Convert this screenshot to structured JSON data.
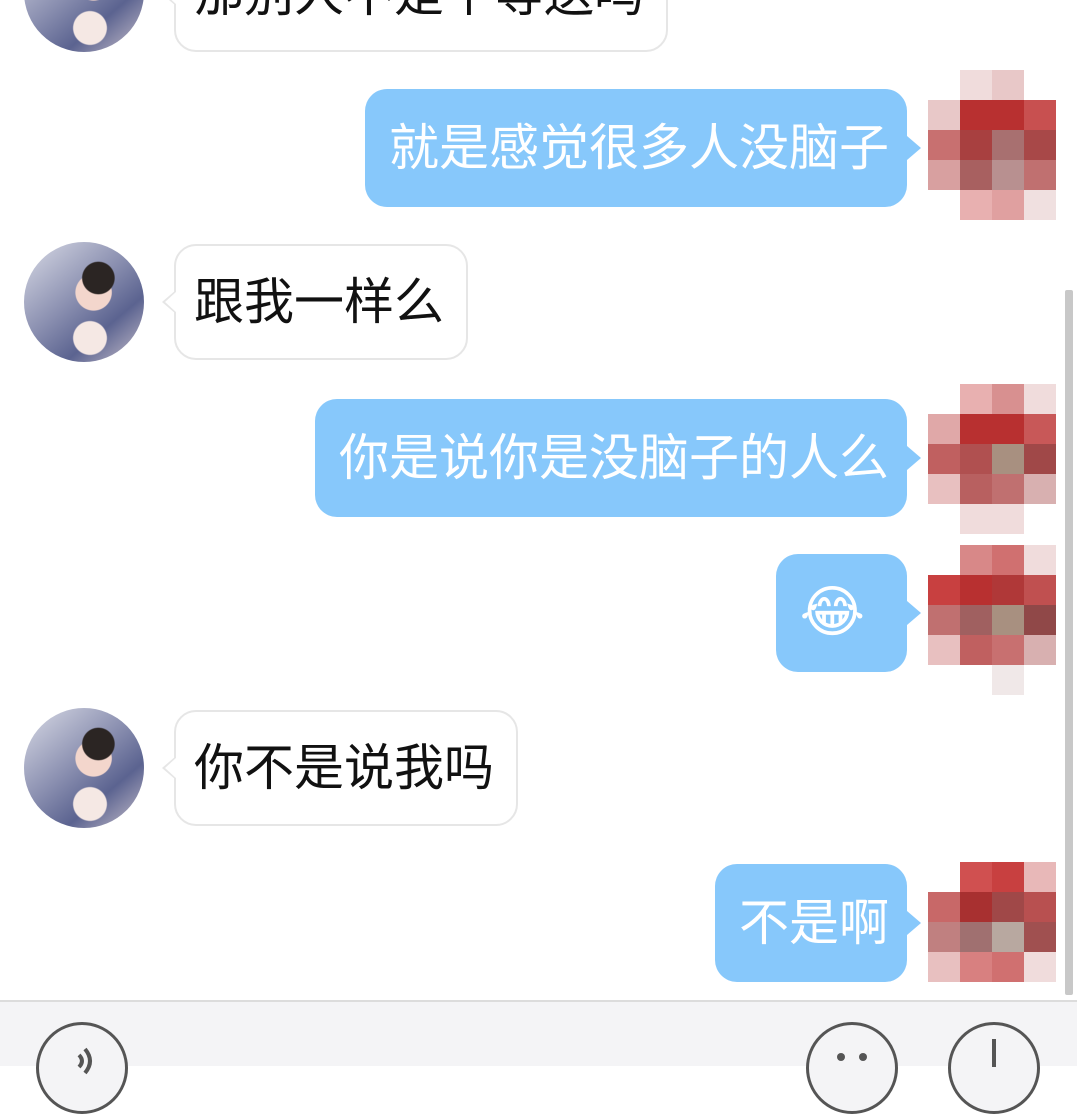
{
  "messages": [
    {
      "side": "in",
      "text": "那别人不是个等送吗"
    },
    {
      "side": "out",
      "text": "就是感觉很多人没脑子"
    },
    {
      "side": "in",
      "text": "跟我一样么"
    },
    {
      "side": "out",
      "text": "你是说你是没脑子的人么"
    },
    {
      "side": "out",
      "text": "😂"
    },
    {
      "side": "in",
      "text": "你不是说我吗"
    },
    {
      "side": "out",
      "text": "不是啊"
    }
  ],
  "input_bar": {
    "voice_icon": "voice-icon",
    "emoji_icon": "emoji-icon",
    "add_icon": "add-icon"
  },
  "colors": {
    "outgoing_bubble": "#87c8fb",
    "incoming_bubble": "#ffffff",
    "incoming_border": "#e6e6e6",
    "background": "#ffffff"
  }
}
